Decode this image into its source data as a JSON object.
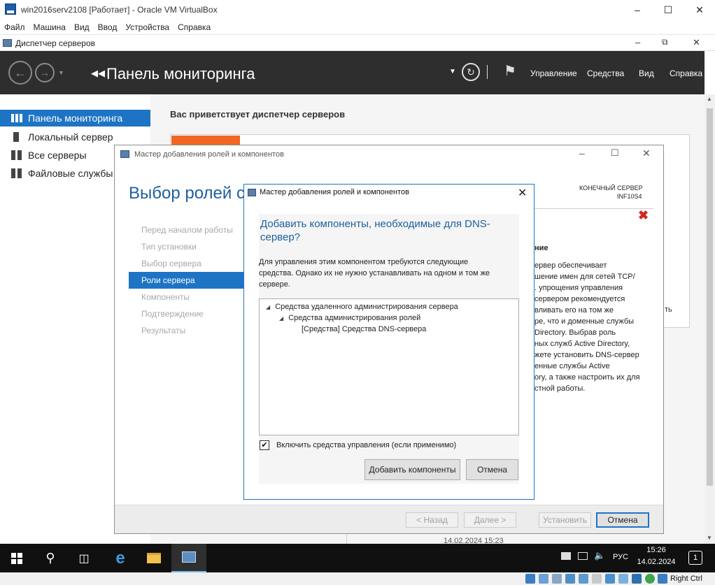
{
  "vbox": {
    "title": "win2016serv2108 [Работает] - Oracle VM VirtualBox",
    "menu": [
      "Файл",
      "Машина",
      "Вид",
      "Ввод",
      "Устройства",
      "Справка"
    ],
    "host_key": "Right Ctrl"
  },
  "server_manager": {
    "window_title": "Диспетчер серверов",
    "header": {
      "title": "Панель мониторинга",
      "menu": [
        "Управление",
        "Средства",
        "Вид",
        "Справка"
      ]
    },
    "sidebar": [
      {
        "label": "Панель мониторинга",
        "active": true
      },
      {
        "label": "Локальный сервер",
        "active": false
      },
      {
        "label": "Все серверы",
        "active": false
      },
      {
        "label": "Файловые службы",
        "active": false
      }
    ],
    "welcome": "Вас приветствует диспетчер серверов",
    "partial_date": "14.02.2024 15:23",
    "partial_text": "ть"
  },
  "wizard": {
    "window_title": "Мастер добавления ролей и компонентов",
    "heading": "Выбор ролей сервера",
    "destination_label": "КОНЕЧНЫЙ СЕРВЕР",
    "destination_server": "INF10S4",
    "steps": [
      {
        "label": "Перед началом работы",
        "active": false
      },
      {
        "label": "Тип установки",
        "active": false
      },
      {
        "label": "Выбор сервера",
        "active": false
      },
      {
        "label": "Роли сервера",
        "active": true
      },
      {
        "label": "Компоненты",
        "active": false
      },
      {
        "label": "Подтверждение",
        "active": false
      },
      {
        "label": "Результаты",
        "active": false
      }
    ],
    "description_heading": "ние",
    "description_lines": [
      "ервер обеспечивает",
      "шение имен для сетей TCP/",
      ". упрощения управления",
      "сервером рекомендуется",
      "вливать его на том же",
      "ре, что и доменные службы",
      "Directory. Выбрав роль",
      "ных служб Active Directory,",
      "жете установить DNS-сервер",
      "енные службы Active",
      "ory, а также настроить их для",
      "стной работы."
    ],
    "buttons": {
      "prev": "< Назад",
      "next": "Далее >",
      "install": "Установить",
      "cancel": "Отмена"
    }
  },
  "dialog": {
    "window_title": "Мастер добавления ролей и компонентов",
    "heading_line1": "Добавить компоненты, необходимые для DNS-",
    "heading_line2": "сервер?",
    "body_lines": [
      "Для управления этим компонентом требуются следующие",
      "средства. Однако их не нужно устанавливать на одном и том же",
      "сервере."
    ],
    "tree": [
      {
        "label": "Средства удаленного администрирования сервера",
        "level": 0,
        "expanded": true
      },
      {
        "label": "Средства администрирования ролей",
        "level": 1,
        "expanded": true
      },
      {
        "label": "[Средства] Средства DNS-сервера",
        "level": 2,
        "expanded": false
      }
    ],
    "include_tools_label": "Включить средства управления (если применимо)",
    "include_tools_checked": true,
    "add_button": "Добавить компоненты",
    "cancel_button": "Отмена"
  },
  "taskbar": {
    "time": "15:26",
    "date": "14.02.2024",
    "language": "РУС",
    "notification_count": "1"
  },
  "colors": {
    "accent": "#1e74c4",
    "header_bg": "#2e2e2e",
    "orange": "#f26522",
    "error_red": "#d6261c",
    "heading_blue": "#1e5f9e"
  }
}
